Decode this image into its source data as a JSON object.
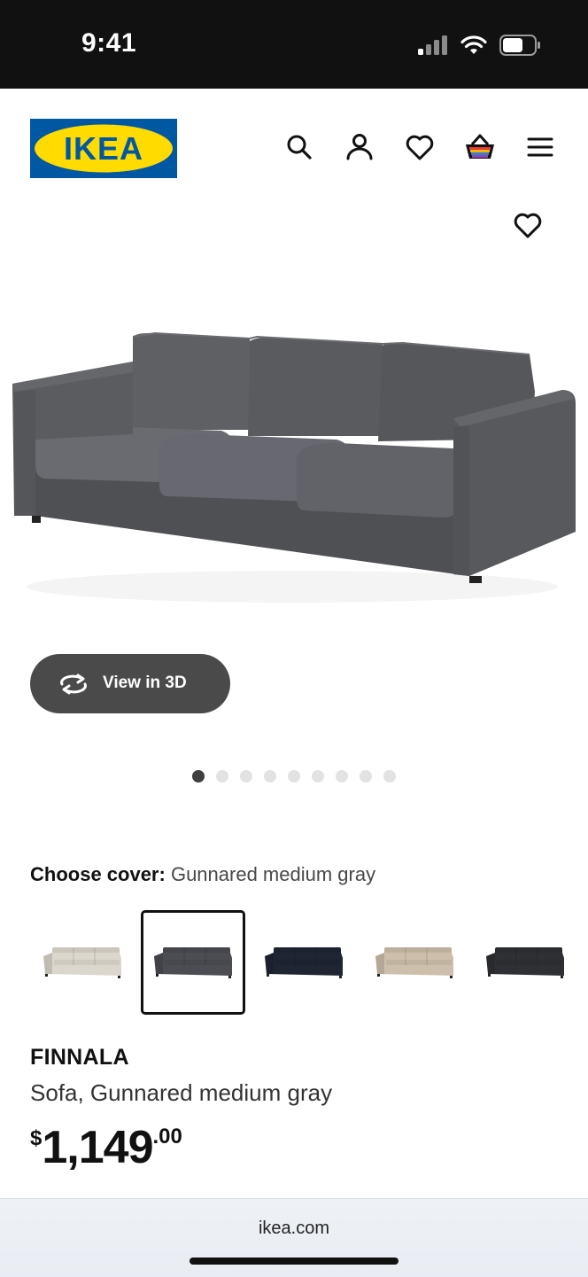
{
  "status_bar": {
    "time": "9:41"
  },
  "header": {
    "logo_text": "IKEA",
    "brand_colors": {
      "blue": "#0058A3",
      "yellow": "#FFDB00"
    },
    "icons": [
      "search-icon",
      "account-icon",
      "heart-icon",
      "basket-icon",
      "menu-icon"
    ]
  },
  "gallery": {
    "view_3d_label": "View in 3D",
    "total_images": 9,
    "active_index": 0
  },
  "cover": {
    "label": "Choose cover:",
    "selected_name": "Gunnared medium gray",
    "options": [
      {
        "color": "#dcd7cc"
      },
      {
        "color": "#4b4d52"
      },
      {
        "color": "#1f2533"
      },
      {
        "color": "#cdbfab"
      },
      {
        "color": "#2f3033"
      }
    ],
    "selected_index": 1
  },
  "product": {
    "name": "FINNALA",
    "description": "Sofa, Gunnared medium gray",
    "price_currency": "$",
    "price_integer": "1,149",
    "price_decimal": ".00"
  },
  "browser": {
    "url": "ikea.com"
  }
}
